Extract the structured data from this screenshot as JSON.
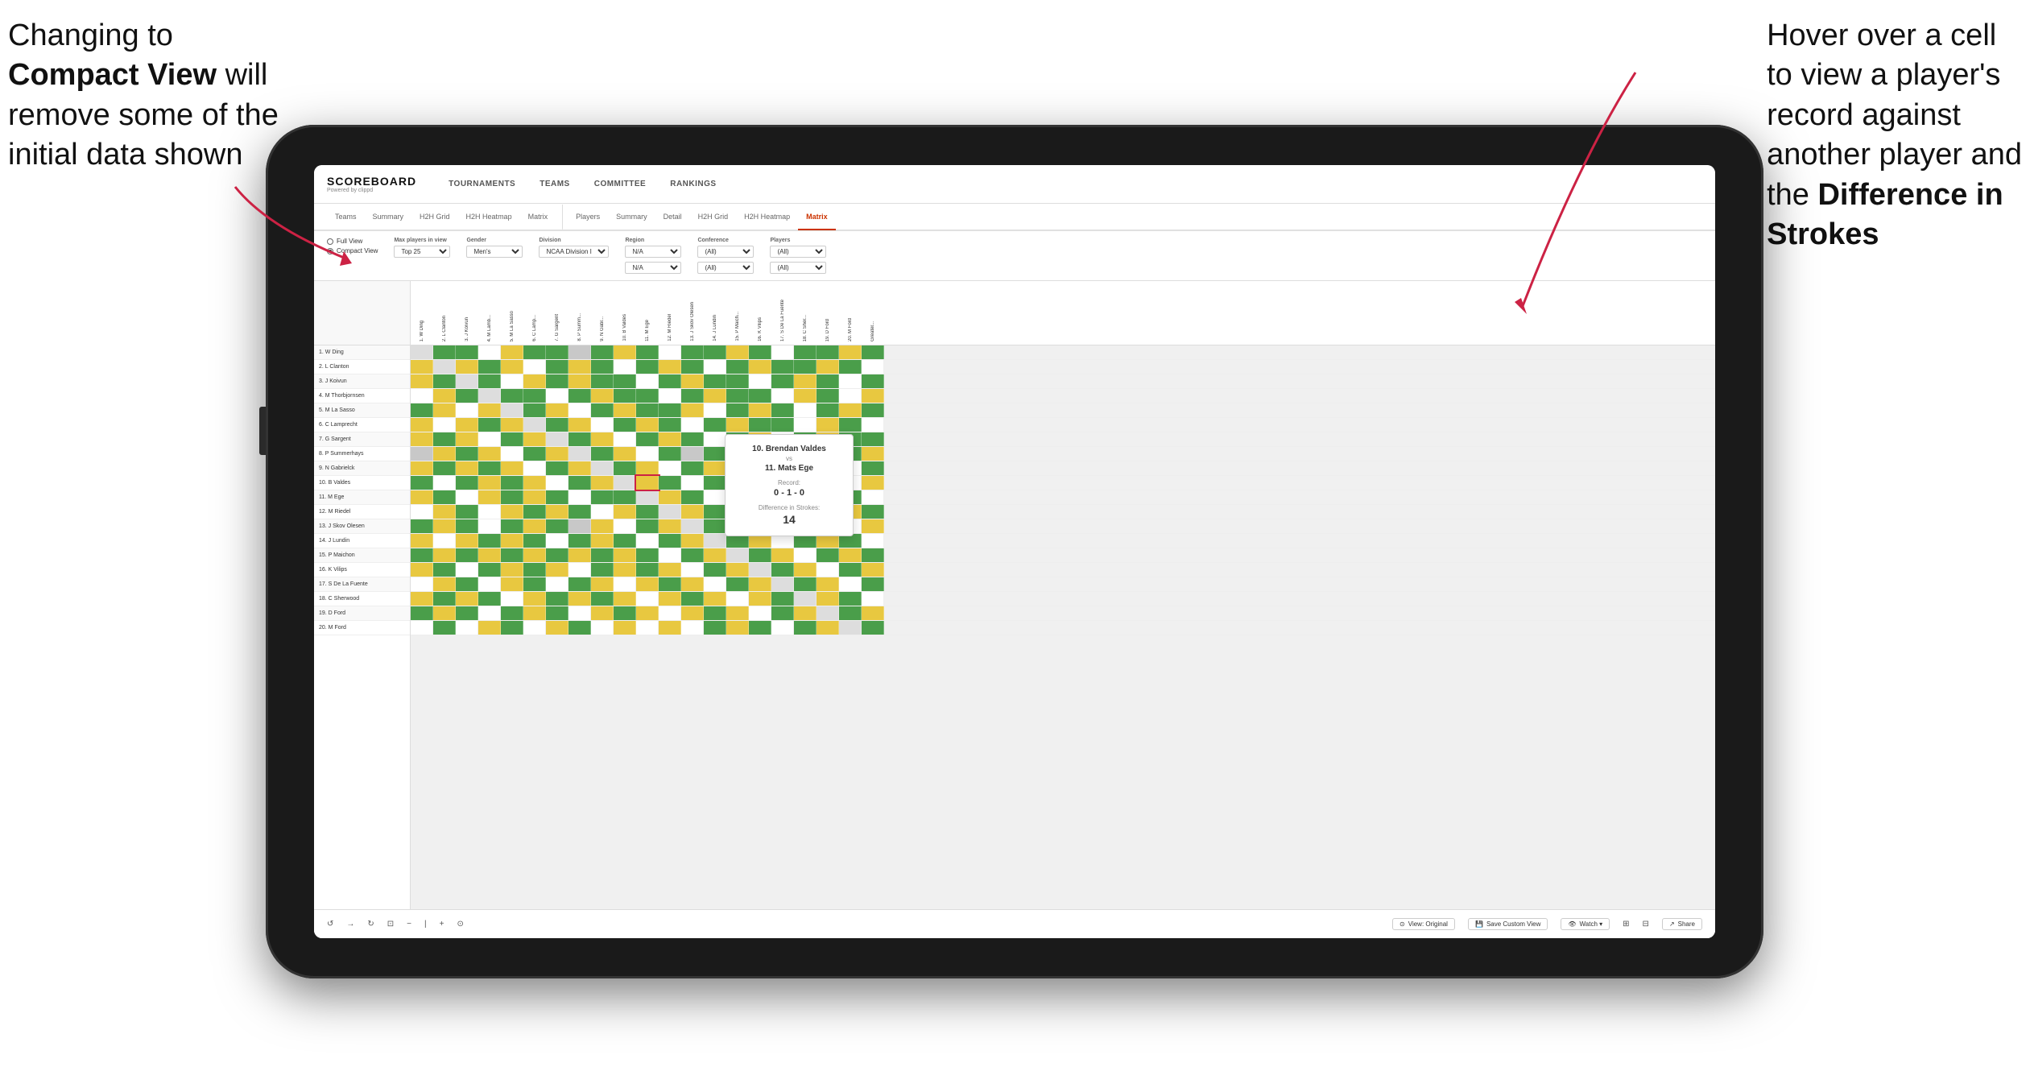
{
  "annotations": {
    "left": {
      "line1": "Changing to",
      "line2": "Compact View",
      "line3": " will",
      "line4": "remove some of the",
      "line5": "initial data shown"
    },
    "right": {
      "line1": "Hover over a cell",
      "line2": "to view a player's",
      "line3": "record against",
      "line4": "another player and",
      "line5": "the ",
      "line6": "Difference in",
      "line7": "Strokes"
    }
  },
  "nav": {
    "logo": "SCOREBOARD",
    "logo_sub": "Powered by clippd",
    "items": [
      "TOURNAMENTS",
      "TEAMS",
      "COMMITTEE",
      "RANKINGS"
    ]
  },
  "sub_tabs": {
    "group1": [
      "Teams",
      "Summary",
      "H2H Grid",
      "H2H Heatmap",
      "Matrix"
    ],
    "group2": [
      "Players",
      "Summary",
      "Detail",
      "H2H Grid",
      "H2H Heatmap",
      "Matrix"
    ]
  },
  "active_sub_tab": "Matrix",
  "filters": {
    "view_options": [
      "Full View",
      "Compact View"
    ],
    "active_view": "Compact View",
    "fields": [
      {
        "label": "Max players in view",
        "value": "Top 25"
      },
      {
        "label": "Gender",
        "value": "Men's"
      },
      {
        "label": "Division",
        "value": "NCAA Division I"
      },
      {
        "label": "Region",
        "value": "N/A"
      },
      {
        "label": "Conference",
        "value": "(All)"
      },
      {
        "label": "Players",
        "value": "(All)"
      }
    ]
  },
  "players": [
    "1. W Ding",
    "2. L Clanton",
    "3. J Koivun",
    "4. M Thorbjornsen",
    "5. M La Sasso",
    "6. C Lamprecht",
    "7. G Sargent",
    "8. P Summerhays",
    "9. N Gabrielck",
    "10. B Valdes",
    "11. M Ege",
    "12. M Riedel",
    "13. J Skov Olesen",
    "14. J Lundin",
    "15. P Maichon",
    "16. K Vilips",
    "17. S De La Fuente",
    "18. C Sherwood",
    "19. D Ford",
    "20. M Ford"
  ],
  "col_headers": [
    "1. W Ding",
    "2. L Clanton",
    "3. J Koivun",
    "4. M Thorb...",
    "5. M La Sasso",
    "6. C Lam...",
    "7. G Sargent",
    "8. P Summ...",
    "9. N Gabr...",
    "10. B Valdes",
    "11. M Ege",
    "12. M Riedel",
    "13. J Skov Olesen",
    "14. J Lundin",
    "15. P Maichon",
    "16. K Vilips",
    "17. S De La Fuente",
    "18. C Sher...",
    "19. D Ford",
    "20. M Ford",
    "Greater..."
  ],
  "tooltip": {
    "player1": "10. Brendan Valdes",
    "vs": "vs",
    "player2": "11. Mats Ege",
    "record_label": "Record:",
    "record": "0 - 1 - 0",
    "diff_label": "Difference in Strokes:",
    "diff_value": "14"
  },
  "toolbar": {
    "undo": "↺",
    "redo": "↻",
    "back": "←",
    "zoom_minus": "−",
    "zoom_plus": "+",
    "zoom_fit": "⊡",
    "view_original": "View: Original",
    "save_custom": "Save Custom View",
    "watch": "Watch ▾",
    "share": "Share"
  }
}
